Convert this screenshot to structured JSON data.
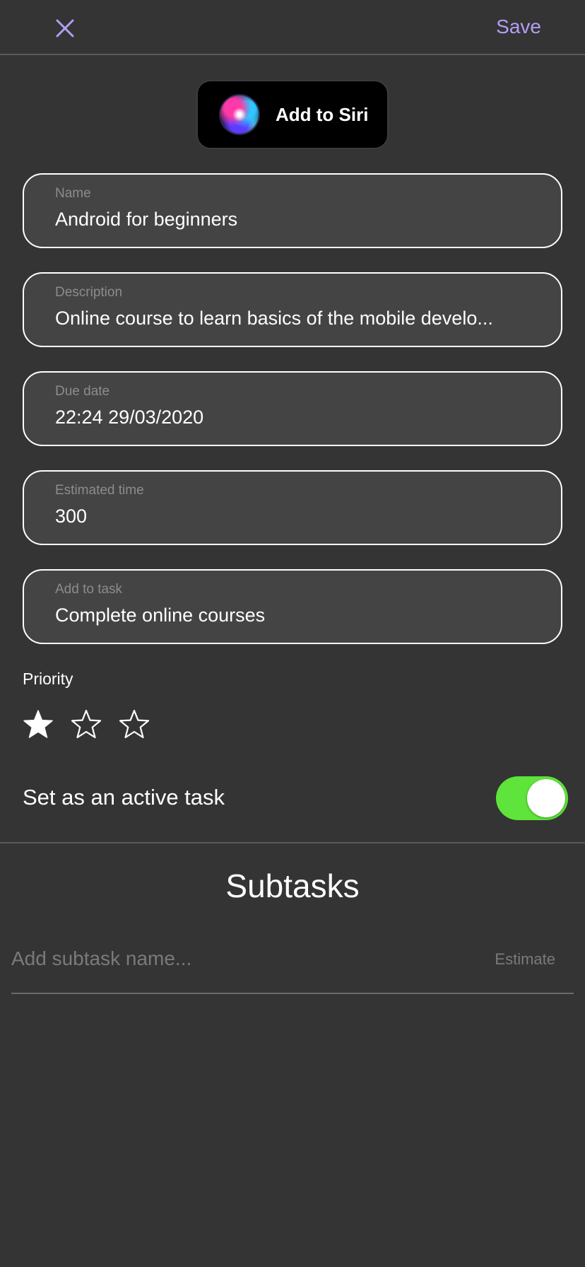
{
  "header": {
    "close_icon": "close-icon",
    "save_label": "Save"
  },
  "siri": {
    "label": "Add to Siri",
    "icon": "siri-icon"
  },
  "fields": {
    "name": {
      "label": "Name",
      "value": "Android for beginners"
    },
    "description": {
      "label": "Description",
      "value": "Online course to learn basics of the mobile develo..."
    },
    "due_date": {
      "label": "Due date",
      "value": "22:24 29/03/2020"
    },
    "estimated_time": {
      "label": "Estimated time",
      "value": "300"
    },
    "add_to_task": {
      "label": "Add to task",
      "value": "Complete online courses"
    }
  },
  "priority": {
    "label": "Priority",
    "rating": 1,
    "max": 3
  },
  "active_task": {
    "label": "Set as an active task",
    "enabled": true
  },
  "subtasks": {
    "title": "Subtasks",
    "name_placeholder": "Add subtask name...",
    "estimate_placeholder": "Estimate"
  },
  "colors": {
    "background": "#343434",
    "accent": "#b39ef2",
    "toggle_on": "#5ee43a",
    "field_bg": "#444444"
  }
}
